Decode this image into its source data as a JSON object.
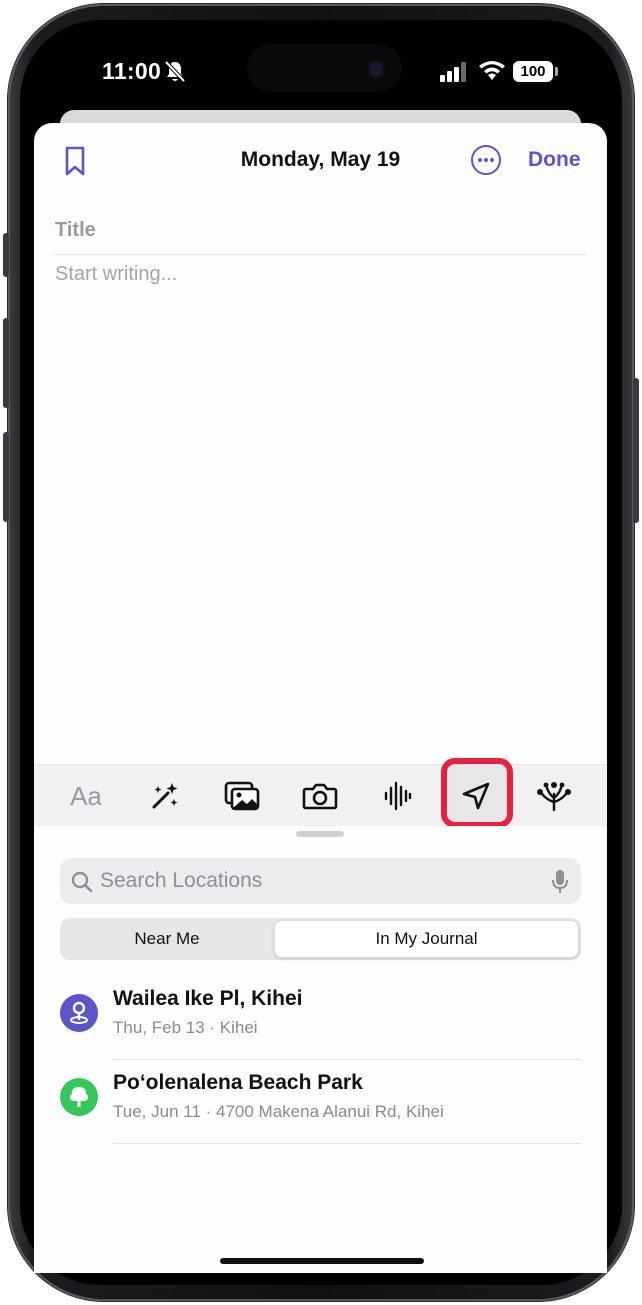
{
  "status_bar": {
    "time": "11:00",
    "battery": "100",
    "icons": [
      "bell-slash-icon",
      "cellular-signal-icon",
      "wifi-icon",
      "battery-icon"
    ]
  },
  "entry": {
    "date": "Monday, May 19",
    "done_label": "Done",
    "title_placeholder": "Title",
    "body_placeholder": "Start writing..."
  },
  "toolbar": {
    "text_style_label": "Aa",
    "tools": [
      "text-style",
      "magic-wand-icon",
      "photo-library-icon",
      "camera-icon",
      "audio-waveform-icon",
      "location-arrow-icon",
      "reflection-prompts-icon"
    ],
    "highlighted": "location-arrow-icon",
    "highlight_color": "#e5223d"
  },
  "locations_panel": {
    "search_placeholder": "Search Locations",
    "segments": [
      "Near Me",
      "In My Journal"
    ],
    "selected_segment": "In My Journal",
    "items": [
      {
        "name": "Wailea Ike Pl, Kihei",
        "subtitle": "Thu, Feb 13 · Kihei",
        "icon": "map-pin-icon",
        "color": "#5b55c9"
      },
      {
        "name": "Poʻolenalena Beach Park",
        "subtitle": "Tue, Jun 11 · 4700 Makena Alanui Rd, Kihei",
        "icon": "tree-icon",
        "color": "#34c759"
      }
    ]
  },
  "colors": {
    "accent": "#5b55c9"
  }
}
